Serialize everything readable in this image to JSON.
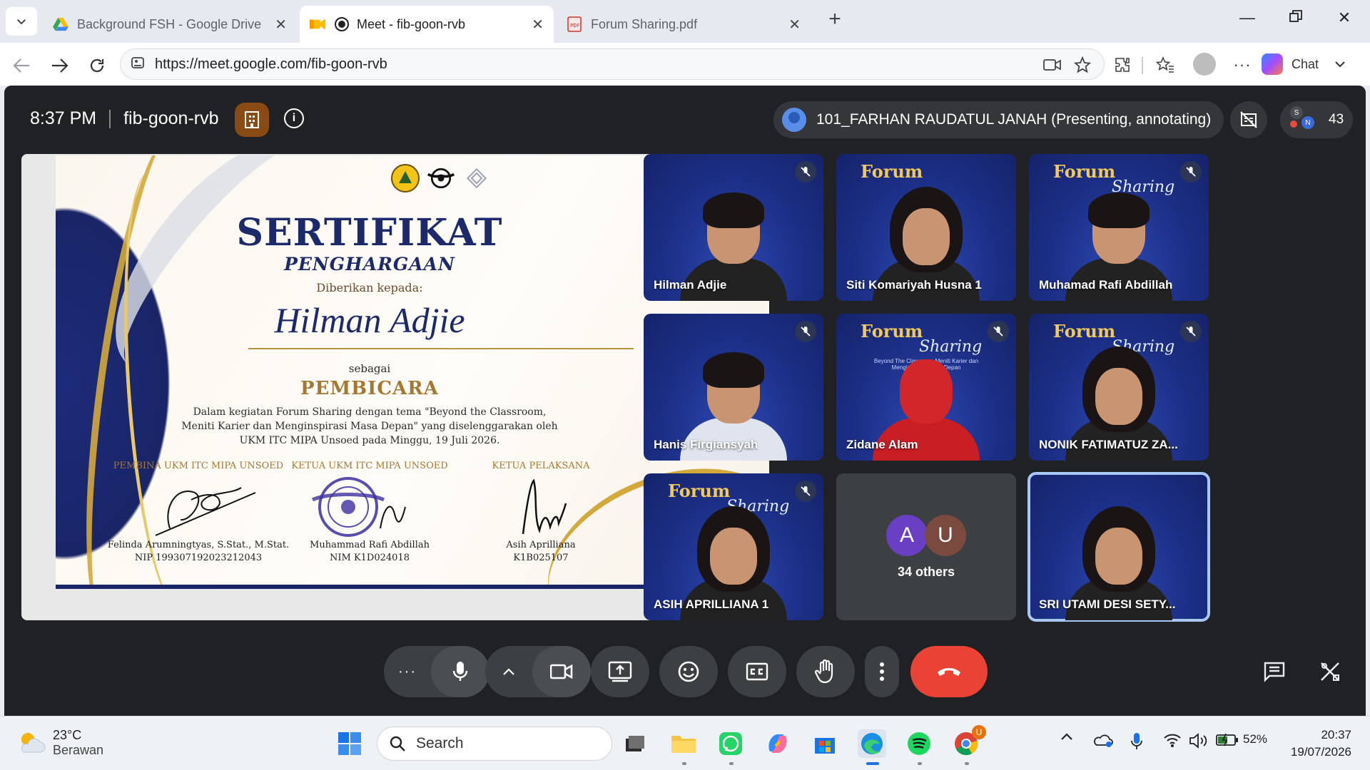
{
  "browser": {
    "tabs": [
      {
        "title": "Background FSH - Google Drive",
        "icon": "google-drive-icon"
      },
      {
        "title": "Meet - fib-goon-rvb",
        "icon": "google-meet-icon"
      },
      {
        "title": "Forum Sharing.pdf",
        "icon": "pdf-icon"
      }
    ],
    "url": "https://meet.google.com/fib-goon-rvb",
    "chat_label": "Chat"
  },
  "meet": {
    "time": "8:37 PM",
    "code": "fib-goon-rvb",
    "presenter": "101_FARHAN RAUDATUL JANAH (Presenting, annotating)",
    "participant_count": "43",
    "mini_avatar_letters": [
      "S",
      "N"
    ]
  },
  "certificate": {
    "title": "SERTIFIKAT",
    "subtitle": "PENGHARGAAN",
    "given_to": "Diberikan kepada:",
    "recipient": "Hilman Adjie",
    "as_label": "sebagai",
    "role": "PEMBICARA",
    "description_lines": [
      "Dalam kegiatan Forum Sharing dengan tema \"Beyond the Classroom,",
      "Meniti Karier dan Menginspirasi Masa Depan\" yang diselenggarakan oleh",
      "UKM ITC MIPA Unsoed pada Minggu, 19 Juli 2026."
    ],
    "signatories": [
      {
        "heading": "PEMBINA UKM ITC MIPA UNSOED",
        "name": "Felinda Arumningtyas, S.Stat., M.Stat.",
        "id": "NIP 199307192023212043"
      },
      {
        "heading": "KETUA UKM ITC MIPA UNSOED",
        "name": "Muhammad Rafi Abdillah",
        "id": "NIM K1D024018"
      },
      {
        "heading": "KETUA PELAKSANA",
        "name": "Asih Aprilliana",
        "id": "K1B025107"
      }
    ]
  },
  "tiles": [
    {
      "name": "Hilman Adjie",
      "muted": true
    },
    {
      "name": "Siti Komariyah Husna 1",
      "muted": false
    },
    {
      "name": "Muhamad Rafi Abdillah",
      "muted": true
    },
    {
      "name": "Hanis Firgiansyah",
      "muted": true
    },
    {
      "name": "Zidane Alam",
      "muted": true
    },
    {
      "name": "NONIK FATIMATUZ ZA...",
      "muted": true
    },
    {
      "name": "ASIH APRILLIANA 1",
      "muted": true
    },
    {
      "name": "34 others",
      "avatars": [
        "A",
        "U"
      ]
    },
    {
      "name": "SRI UTAMI DESI SETY...",
      "muted": false
    }
  ],
  "tile_backdrop": {
    "forum": "Forum",
    "sharing": "Sharing",
    "tagline": "Beyond The Classroom Meniti Karier dan Menginspirasi Masa Depan"
  },
  "taskbar": {
    "temperature": "23°C",
    "weather": "Berawan",
    "search_placeholder": "Search",
    "battery": "52%",
    "time": "20:37",
    "date": "19/07/2026",
    "spotify_badge": "U"
  },
  "colors": {
    "meet_bg": "#202124",
    "end_call": "#ea4335",
    "tile_blue": "#1d2f87",
    "cert_navy": "#1c2a6b",
    "cert_gold": "#a6772f"
  }
}
